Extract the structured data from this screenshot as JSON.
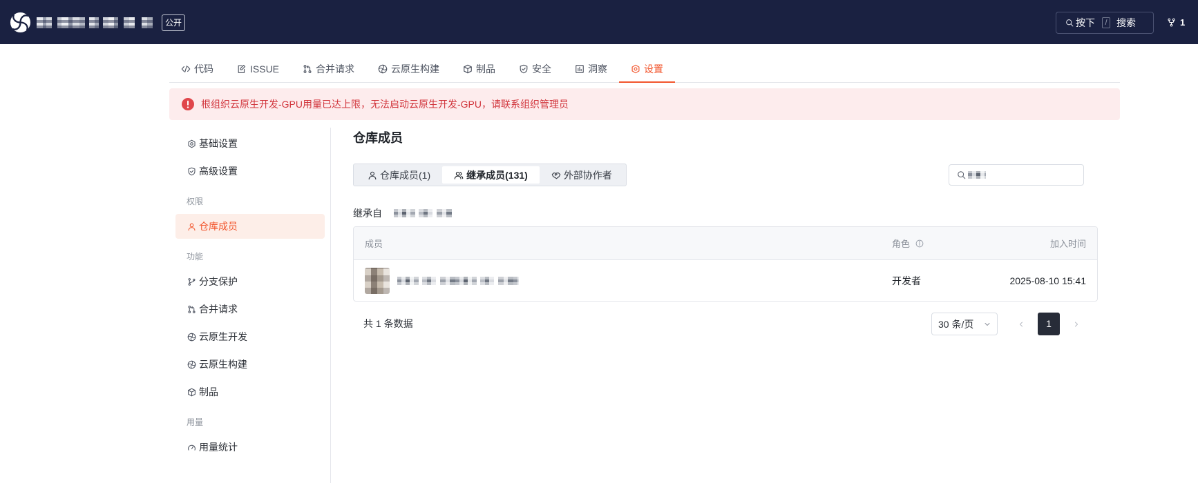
{
  "theme": {
    "header_bg": "#1a2141",
    "accent": "#f2552c",
    "alert_bg": "#fdeced",
    "alert_text": "#d1343b",
    "alert_icon": "#e0464b",
    "active_bg": "#fdeee8",
    "page_active_bg": "#272c38"
  },
  "header": {
    "logo_icon": "pinwheel-logo-icon",
    "visibility_badge": "公开",
    "search": {
      "icon": "search-icon",
      "press_label": "按下",
      "shortcut_key": "/",
      "label": "搜索"
    },
    "fork": {
      "icon": "fork-icon",
      "count": "1"
    }
  },
  "repo_tabs": [
    {
      "label": "代码",
      "icon": "code-icon"
    },
    {
      "label": "ISSUE",
      "icon": "issue-icon"
    },
    {
      "label": "合并请求",
      "icon": "merge-request-icon"
    },
    {
      "label": "云原生构建",
      "icon": "cloud-build-icon"
    },
    {
      "label": "制品",
      "icon": "package-icon"
    },
    {
      "label": "安全",
      "icon": "shield-icon"
    },
    {
      "label": "洞察",
      "icon": "insights-icon"
    },
    {
      "label": "设置",
      "icon": "settings-icon",
      "active": true
    }
  ],
  "alert": {
    "icon": "error-icon",
    "message": "根组织云原生开发-GPU用量已达上限，无法启动云原生开发-GPU，请联系组织管理员"
  },
  "sidebar": {
    "general": [
      {
        "label": "基础设置",
        "icon": "settings-icon"
      },
      {
        "label": "高级设置",
        "icon": "shield-icon"
      }
    ],
    "sections": [
      {
        "title": "权限",
        "items": [
          {
            "label": "仓库成员",
            "icon": "user-icon",
            "active": true
          }
        ]
      },
      {
        "title": "功能",
        "items": [
          {
            "label": "分支保护",
            "icon": "branch-icon"
          },
          {
            "label": "合并请求",
            "icon": "merge-request-icon"
          },
          {
            "label": "云原生开发",
            "icon": "cloud-dev-icon"
          },
          {
            "label": "云原生构建",
            "icon": "cloud-build-icon"
          },
          {
            "label": "制品",
            "icon": "package-icon"
          }
        ]
      },
      {
        "title": "用量",
        "items": [
          {
            "label": "用量统计",
            "icon": "gauge-icon"
          }
        ]
      }
    ]
  },
  "members": {
    "title": "仓库成员",
    "tabs": [
      {
        "label": "仓库成员(1)",
        "icon": "user-icon"
      },
      {
        "label": "继承成员(131)",
        "icon": "users-icon",
        "active": true
      },
      {
        "label": "外部协作者",
        "icon": "handshake-icon"
      }
    ],
    "search_icon": "search-icon",
    "inherited_from_label": "继承自",
    "table": {
      "columns": [
        "成员",
        "角色",
        "加入时间"
      ],
      "role_info_icon": "info-icon",
      "rows": [
        {
          "role": "开发者",
          "joined_at": "2025-08-10 15:41"
        }
      ]
    },
    "pagination": {
      "total_text": "共 1 条数据",
      "page_size": "30 条/页",
      "current_page": "1"
    }
  }
}
